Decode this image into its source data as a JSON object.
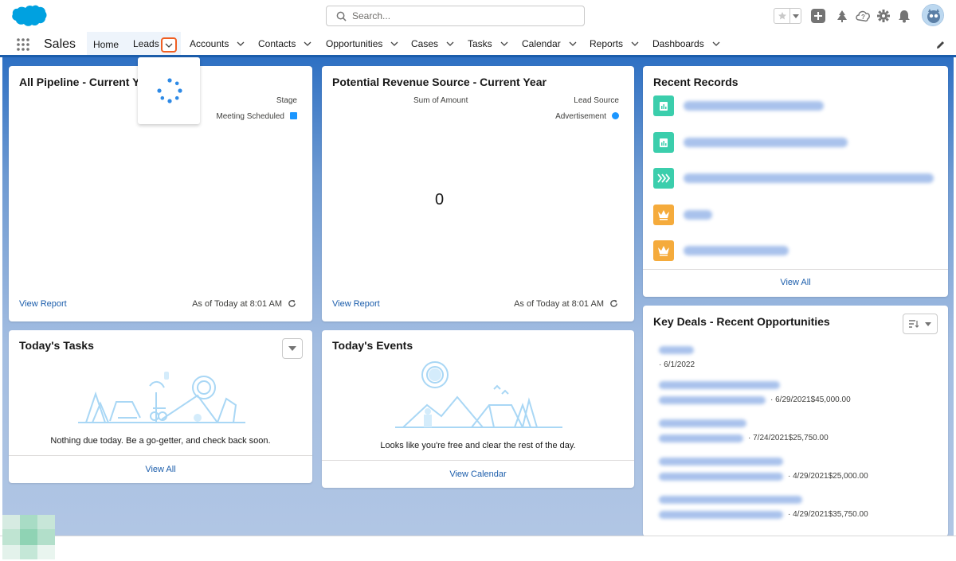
{
  "header": {
    "search_placeholder": "Search..."
  },
  "nav": {
    "app_name": "Sales",
    "items": [
      "Home",
      "Leads",
      "Accounts",
      "Contacts",
      "Opportunities",
      "Cases",
      "Tasks",
      "Calendar",
      "Reports",
      "Dashboards"
    ]
  },
  "cards": {
    "pipeline": {
      "title": "All Pipeline - Current Year",
      "legend_title": "Stage",
      "legend_item": "Meeting Scheduled",
      "legend_color": "#1b96ff",
      "view_report": "View Report",
      "timestamp": "As of Today at 8:01 AM"
    },
    "revenue": {
      "title": "Potential Revenue Source - Current Year",
      "measure": "Sum of Amount",
      "legend_title": "Lead Source",
      "legend_item": "Advertisement",
      "legend_color": "#1b96ff",
      "value": "0",
      "view_report": "View Report",
      "timestamp": "As of Today at 8:01 AM"
    },
    "recent_records": {
      "title": "Recent Records",
      "view_all": "View All"
    },
    "tasks": {
      "title": "Today's Tasks",
      "empty_text": "Nothing due today. Be a go-getter, and check back soon.",
      "view_all": "View All"
    },
    "events": {
      "title": "Today's Events",
      "empty_text": "Looks like you're free and clear the rest of the day.",
      "view_calendar": "View Calendar"
    },
    "key_deals": {
      "title": "Key Deals - Recent Opportunities",
      "deals": [
        {
          "meta": "· 6/1/2022"
        },
        {
          "meta": "· 6/29/2021$45,000.00"
        },
        {
          "meta": "· 7/24/2021$25,750.00"
        },
        {
          "meta": "· 4/29/2021$25,000.00"
        },
        {
          "meta": "· 4/29/2021$35,750.00"
        }
      ]
    }
  },
  "colors": {
    "brand": "#1b5dab",
    "link": "#1b5dab",
    "highlight": "#f05f23",
    "teal": "#3bceac",
    "orange": "#f5ab3c"
  }
}
